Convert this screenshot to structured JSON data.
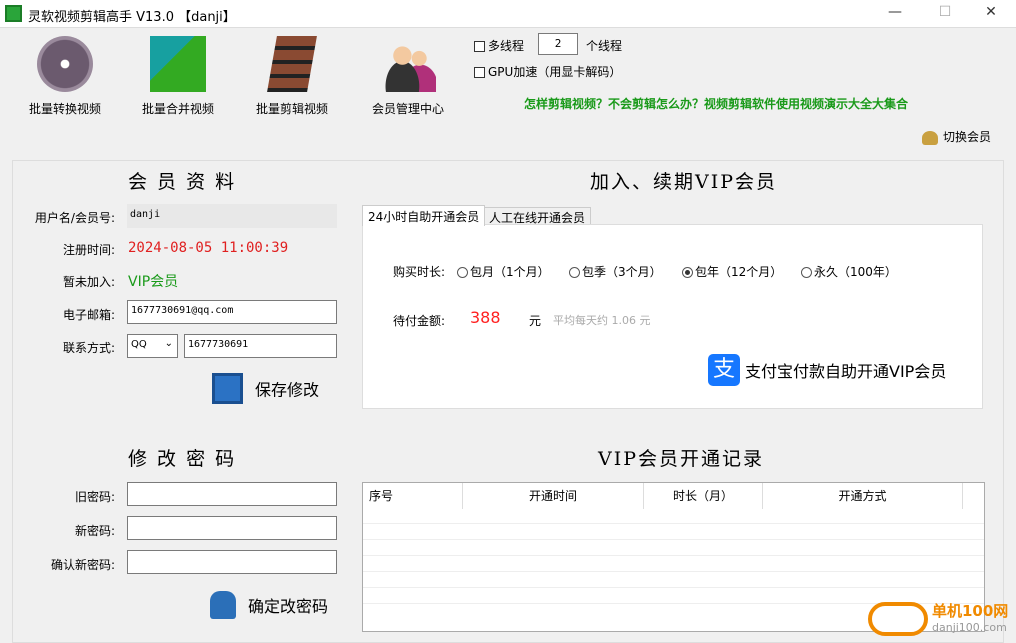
{
  "window": {
    "title": "灵软视频剪辑高手 V13.0 【danji】",
    "minimize": "—",
    "maximize": "☐",
    "close": "✕"
  },
  "toolbar": {
    "items": [
      {
        "label": "批量转换视频",
        "icon": "film-reel-icon"
      },
      {
        "label": "批量合并视频",
        "icon": "film-merge-icon"
      },
      {
        "label": "批量剪辑视频",
        "icon": "film-cut-icon"
      },
      {
        "label": "会员管理中心",
        "icon": "members-icon"
      }
    ],
    "multithread_label": "多线程",
    "thread_count": "2",
    "thread_unit": "个线程",
    "gpu_label": "GPU加速（用显卡解码）",
    "help_link": "怎样剪辑视频？不会剪辑怎么办？视频剪辑软件使用视频演示大全大集合",
    "switch_member": "切换会员"
  },
  "profile": {
    "title": "会 员 资 料",
    "username_label": "用户名/会员号:",
    "username": "danji",
    "reg_label": "注册时间:",
    "reg_time": "2024-08-05 11:00:39",
    "join_label": "暂未加入:",
    "join_value": "VIP会员",
    "email_label": "电子邮箱:",
    "email": "1677730691@qq.com",
    "contact_label": "联系方式:",
    "contact_type": "QQ",
    "contact_value": "1677730691",
    "save": "保存修改"
  },
  "password": {
    "title": "修 改 密 码",
    "old_label": "旧密码:",
    "new_label": "新密码:",
    "confirm_label": "确认新密码:",
    "submit": "确定改密码"
  },
  "vip": {
    "title": "加入、续期VIP会员",
    "tabs": [
      "24小时自助开通会员",
      "人工在线开通会员"
    ],
    "duration_label": "购买时长:",
    "options": [
      {
        "label": "包月（1个月）",
        "selected": false
      },
      {
        "label": "包季（3个月）",
        "selected": false
      },
      {
        "label": "包年（12个月）",
        "selected": true
      },
      {
        "label": "永久（100年）",
        "selected": false
      }
    ],
    "amount_label": "待付金额:",
    "amount": "388",
    "unit": "元",
    "avg": "平均每天约 1.06 元",
    "pay": "支付宝付款自助开通VIP会员",
    "accent": "#1677ff",
    "price_color": "#ff2020"
  },
  "records": {
    "title": "VIP会员开通记录",
    "columns": [
      "序号",
      "开通时间",
      "时长（月）",
      "开通方式"
    ],
    "rows": []
  },
  "watermark": {
    "text": "单机100网",
    "url_text": "danji100.com"
  }
}
